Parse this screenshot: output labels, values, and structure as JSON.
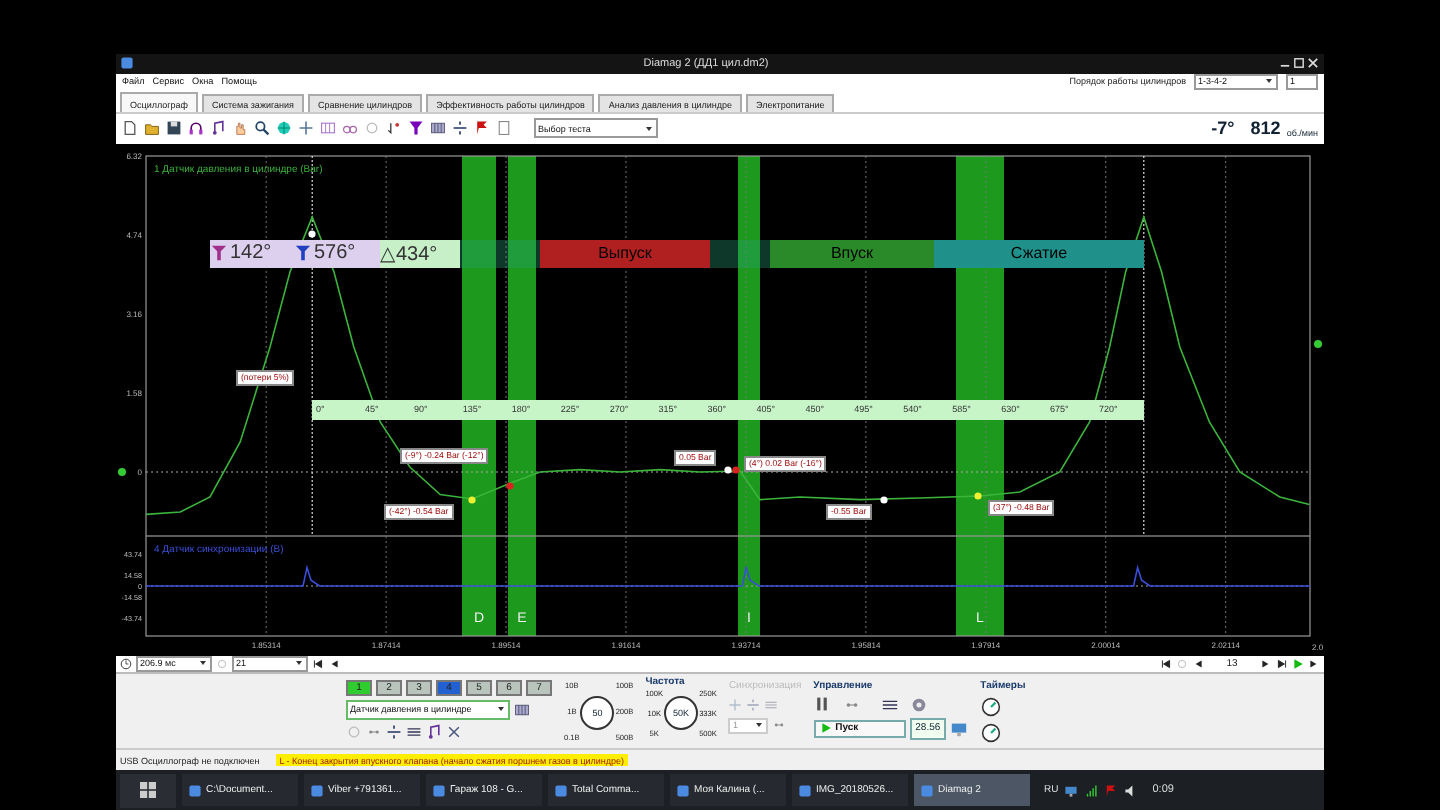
{
  "window": {
    "title": "Diamag 2 (ДД1 цил.dm2)"
  },
  "menu": [
    "Файл",
    "Сервис",
    "Окна",
    "Помощь"
  ],
  "cylinder_order": {
    "label": "Порядок работы цилиндров",
    "value": "1-3-4-2",
    "spinner": "1"
  },
  "tabs": [
    {
      "label": "Осциллограф",
      "selected": true
    },
    {
      "label": "Система зажигания",
      "selected": false
    },
    {
      "label": "Сравнение цилиндров",
      "selected": false
    },
    {
      "label": "Эффективность работы цилиндров",
      "selected": false
    },
    {
      "label": "Анализ давления в цилиндре",
      "selected": false
    },
    {
      "label": "Электропитание",
      "selected": false
    }
  ],
  "toolbar": {
    "test_select": "Выбор теста",
    "angle": "-7°",
    "rpm": "812",
    "rpm_unit": "об./мин"
  },
  "plot": {
    "channels": [
      {
        "chart_data": {
          "type": "line",
          "x": [
            1.8321,
            1.8381,
            1.8433,
            1.8486,
            1.8538,
            1.8573,
            1.8612,
            1.865,
            1.8685,
            1.8731,
            1.8783,
            1.8836,
            1.8892,
            1.8955,
            1.9011,
            1.9081,
            1.9151,
            1.9221,
            1.9291,
            1.9361,
            1.9396,
            1.9466,
            1.9571,
            1.9676,
            1.9781,
            1.9851,
            1.9921,
            1.9973,
            2.0008,
            2.0036,
            2.0068,
            2.0099,
            2.0131,
            2.0183,
            2.0236,
            2.0306,
            2.0358
          ],
          "series": [
            {
              "name": "1 Датчик давления в цилиндре (Bar)",
              "color": "#3cb43c",
              "values": [
                -0.85,
                -0.8,
                -0.5,
                0.6,
                2.5,
                4.0,
                5.1,
                4.0,
                2.5,
                1.0,
                0.1,
                -0.45,
                -0.54,
                -0.24,
                0.0,
                0.05,
                0.0,
                0.05,
                0.0,
                0.02,
                -0.55,
                -0.5,
                -0.55,
                -0.52,
                -0.48,
                -0.4,
                0.0,
                1.0,
                2.5,
                4.0,
                5.1,
                4.0,
                2.5,
                1.0,
                0.0,
                -0.5,
                -0.65
              ]
            }
          ],
          "xlim": [
            1.8321,
            2.0359
          ],
          "ylim": [
            -1.28,
            6.32
          ],
          "yticks": [
            0,
            1.58,
            3.16,
            4.74,
            6.32
          ],
          "grid": true,
          "ref_lines": [
            {
              "axis": "y",
              "value": 0
            },
            {
              "axis": "x",
              "value": 1.8612
            },
            {
              "axis": "x",
              "value": 2.0068
            }
          ]
        }
      },
      {
        "chart_data": {
          "type": "line",
          "x": [
            1.8321,
            1.8596,
            1.8603,
            1.861,
            1.8625,
            1.9365,
            1.9372,
            1.9379,
            1.9394,
            2.005,
            2.0057,
            2.0064,
            2.0079,
            2.0359
          ],
          "series": [
            {
              "name": "4 Датчик синхронизации (В)",
              "color": "#3a4fd8",
              "values": [
                0,
                0,
                25,
                8,
                0,
                0,
                25,
                8,
                0,
                0,
                25,
                8,
                0,
                0
              ]
            }
          ],
          "xlim": [
            1.8321,
            2.0359
          ],
          "ylim": [
            -68,
            68
          ],
          "yticks": [
            -43.74,
            -14.58,
            0,
            14.58,
            43.74
          ],
          "grid": true,
          "ref_lines": [
            {
              "axis": "y",
              "value": 0
            }
          ],
          "xticks": [
            {
              "value": 1.85314,
              "label": "1.85314"
            },
            {
              "value": 1.87414,
              "label": "1.87414"
            },
            {
              "value": 1.89514,
              "label": "1.89514"
            },
            {
              "value": 1.91614,
              "label": "1.91614"
            },
            {
              "value": 1.93714,
              "label": "1.93714"
            },
            {
              "value": 1.95814,
              "label": "1.95814"
            },
            {
              "value": 1.97914,
              "label": "1.97914"
            },
            {
              "value": 2.00014,
              "label": "2.00014"
            },
            {
              "value": 2.02114,
              "label": "2.02114"
            }
          ]
        }
      }
    ],
    "bands": [
      {
        "label": "D"
      },
      {
        "label": "E"
      },
      {
        "label": "I"
      },
      {
        "label": "L"
      }
    ],
    "phase_bar": [
      {
        "kind": "cursor",
        "label": "142°",
        "color": "#a0308a"
      },
      {
        "kind": "cursor",
        "label": "576°",
        "color": "#2040c0"
      },
      {
        "kind": "delta",
        "label": "△434°"
      },
      {
        "kind": "phase",
        "label": "Выпуск",
        "color": "#b02020"
      },
      {
        "kind": "phase",
        "label": "Впуск",
        "color": "#2a8a2a"
      },
      {
        "kind": "phase",
        "label": "Сжатие",
        "color": "#20908a"
      }
    ],
    "cut_tick_label": "2.0",
    "degree_scale": [
      "0°",
      "45°",
      "90°",
      "135°",
      "180°",
      "225°",
      "270°",
      "315°",
      "360°",
      "405°",
      "450°",
      "495°",
      "540°",
      "585°",
      "630°",
      "675°",
      "720°"
    ],
    "annotations": [
      "(потери 5%)",
      "(-9°) -0.24 Bar (-12°)",
      "(-42°) -0.54 Bar",
      "0.05 Bar",
      "(4°) 0.02 Bar (-16°)",
      "-0.55 Bar",
      "(37°) -0.48 Bar"
    ]
  },
  "playback": {
    "duration": "206.9 мс",
    "count": "21",
    "frame": "13"
  },
  "channel_buttons": [
    {
      "label": "1",
      "color": "#2ecc2e"
    },
    {
      "label": "2",
      "color": "#b8c4bc"
    },
    {
      "label": "3",
      "color": "#b8c4bc"
    },
    {
      "label": "4",
      "color": "#2360d0"
    },
    {
      "label": "5",
      "color": "#b8c4bc"
    },
    {
      "label": "6",
      "color": "#b8c4bc"
    },
    {
      "label": "7",
      "color": "#b8c4bc"
    }
  ],
  "sensor_select": "Датчик давления в цилиндре",
  "range_knob": {
    "labels": [
      "10В",
      "100В",
      "1В",
      "200В",
      "0.1В",
      "500В"
    ],
    "value": "50"
  },
  "frequency": {
    "title": "Частота",
    "labels": [
      "100K",
      "250K",
      "10K",
      "333K",
      "5K",
      "500K"
    ],
    "value": "50K"
  },
  "sync": {
    "title": "Синхронизация",
    "disabled": true,
    "value": "1"
  },
  "control": {
    "title": "Управление",
    "start": "Пуск",
    "reading": "28.56"
  },
  "timers": {
    "title": "Таймеры"
  },
  "status_bar": {
    "connection": "USB Осциллограф не подключен",
    "hint": "L - Конец закрытия впускного клапана (начало сжатия поршнем газов в цилиндре)"
  },
  "taskbar": {
    "items": [
      {
        "label": "C:\\Document...",
        "selected": false
      },
      {
        "label": "Viber +791361...",
        "selected": false
      },
      {
        "label": "Гараж 108 - G...",
        "selected": false
      },
      {
        "label": "Total Comma...",
        "selected": false
      },
      {
        "label": "Моя Калина (...",
        "selected": false
      },
      {
        "label": "IMG_20180526...",
        "selected": false
      },
      {
        "label": "Diamag 2",
        "selected": true
      }
    ],
    "language": "RU",
    "clock": "0:09"
  }
}
